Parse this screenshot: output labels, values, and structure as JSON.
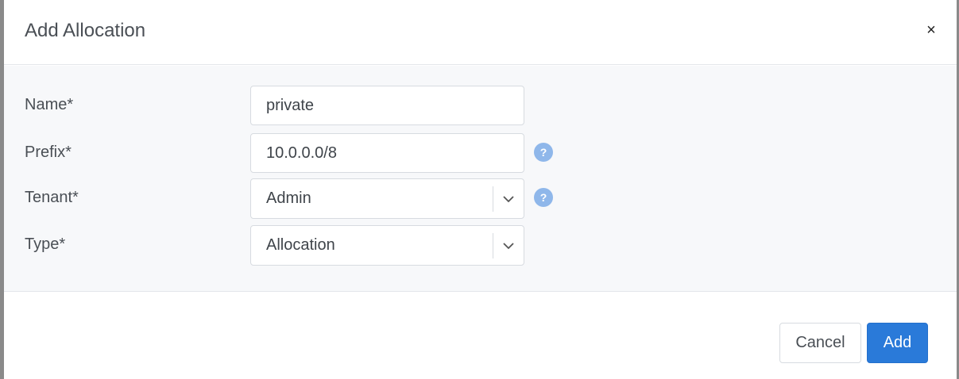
{
  "dialog": {
    "title": "Add Allocation",
    "close_symbol": "×"
  },
  "form": {
    "name": {
      "label": "Name*",
      "value": "private"
    },
    "prefix": {
      "label": "Prefix*",
      "value": "10.0.0.0/8",
      "help": "?"
    },
    "tenant": {
      "label": "Tenant*",
      "value": "Admin",
      "help": "?"
    },
    "type": {
      "label": "Type*",
      "value": "Allocation"
    }
  },
  "footer": {
    "cancel_label": "Cancel",
    "add_label": "Add"
  },
  "icons": {
    "close": "close-icon",
    "help": "help-circle-icon",
    "dropdown": "chevron-down-icon"
  },
  "colors": {
    "primary": "#2a7ad9",
    "help_icon": "#8fb7ea",
    "body_bg": "#f7f8fa"
  }
}
